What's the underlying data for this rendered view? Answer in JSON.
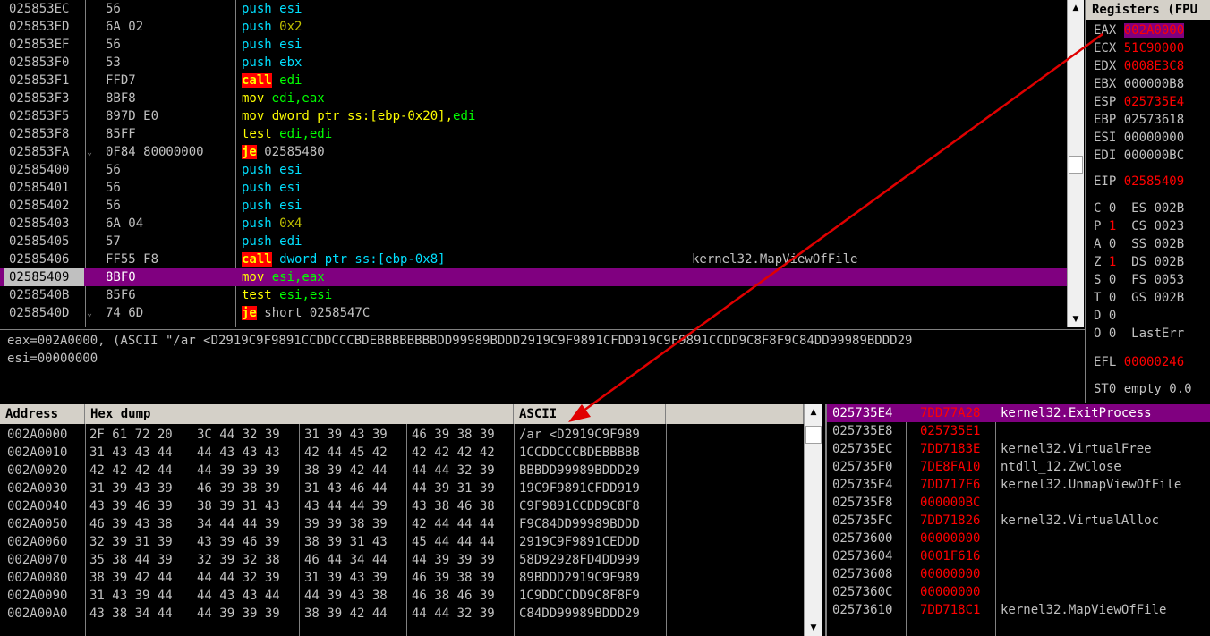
{
  "cpu_rows": [
    {
      "addr": "025853EC",
      "arrow": "",
      "hex": "56",
      "parts": [
        {
          "t": "push ",
          "c": "kw-push"
        },
        {
          "t": "esi",
          "c": "op-mem"
        }
      ],
      "comment": ""
    },
    {
      "addr": "025853ED",
      "arrow": "",
      "hex": "6A 02",
      "parts": [
        {
          "t": "push ",
          "c": "kw-push"
        },
        {
          "t": "0x2",
          "c": "op-imm"
        }
      ],
      "comment": ""
    },
    {
      "addr": "025853EF",
      "arrow": "",
      "hex": "56",
      "parts": [
        {
          "t": "push ",
          "c": "kw-push"
        },
        {
          "t": "esi",
          "c": "op-mem"
        }
      ],
      "comment": ""
    },
    {
      "addr": "025853F0",
      "arrow": "",
      "hex": "53",
      "parts": [
        {
          "t": "push ",
          "c": "kw-push"
        },
        {
          "t": "ebx",
          "c": "op-mem"
        }
      ],
      "comment": ""
    },
    {
      "addr": "025853F1",
      "arrow": "",
      "hex": "FFD7",
      "parts": [
        {
          "t": "call",
          "c": "kw-call"
        },
        {
          "t": " edi",
          "c": "op-reg"
        }
      ],
      "comment": ""
    },
    {
      "addr": "025853F3",
      "arrow": "",
      "hex": "8BF8",
      "parts": [
        {
          "t": "mov ",
          "c": "kw-mov"
        },
        {
          "t": "edi,eax",
          "c": "op-reg"
        }
      ],
      "comment": ""
    },
    {
      "addr": "025853F5",
      "arrow": "",
      "hex": "897D E0",
      "parts": [
        {
          "t": "mov dword ptr ss:[ebp-0x20],",
          "c": "kw-mov"
        },
        {
          "t": "edi",
          "c": "op-reg"
        }
      ],
      "comment": ""
    },
    {
      "addr": "025853F8",
      "arrow": "",
      "hex": "85FF",
      "parts": [
        {
          "t": "test ",
          "c": "kw-test"
        },
        {
          "t": "edi,edi",
          "c": "op-reg"
        }
      ],
      "comment": ""
    },
    {
      "addr": "025853FA",
      "arrow": "⌄",
      "hex": "0F84 80000000",
      "parts": [
        {
          "t": "je",
          "c": "kw-je"
        },
        {
          "t": " 02585480",
          "c": ""
        }
      ],
      "comment": ""
    },
    {
      "addr": "02585400",
      "arrow": "",
      "hex": "56",
      "parts": [
        {
          "t": "push ",
          "c": "kw-push"
        },
        {
          "t": "esi",
          "c": "op-mem"
        }
      ],
      "comment": ""
    },
    {
      "addr": "02585401",
      "arrow": "",
      "hex": "56",
      "parts": [
        {
          "t": "push ",
          "c": "kw-push"
        },
        {
          "t": "esi",
          "c": "op-mem"
        }
      ],
      "comment": ""
    },
    {
      "addr": "02585402",
      "arrow": "",
      "hex": "56",
      "parts": [
        {
          "t": "push ",
          "c": "kw-push"
        },
        {
          "t": "esi",
          "c": "op-mem"
        }
      ],
      "comment": ""
    },
    {
      "addr": "02585403",
      "arrow": "",
      "hex": "6A 04",
      "parts": [
        {
          "t": "push ",
          "c": "kw-push"
        },
        {
          "t": "0x4",
          "c": "op-imm"
        }
      ],
      "comment": ""
    },
    {
      "addr": "02585405",
      "arrow": "",
      "hex": "57",
      "parts": [
        {
          "t": "push ",
          "c": "kw-push"
        },
        {
          "t": "edi",
          "c": "op-mem"
        }
      ],
      "comment": ""
    },
    {
      "addr": "02585406",
      "arrow": "",
      "hex": "FF55 F8",
      "parts": [
        {
          "t": "call",
          "c": "kw-call"
        },
        {
          "t": " dword ptr ss:[ebp-0x8]",
          "c": "op-mem"
        }
      ],
      "comment": "kernel32.MapViewOfFile"
    },
    {
      "addr": "02585409",
      "arrow": "",
      "hex": "8BF0",
      "parts": [
        {
          "t": "mov ",
          "c": "kw-mov"
        },
        {
          "t": "esi,eax",
          "c": "op-reg"
        }
      ],
      "comment": "",
      "selected": true
    },
    {
      "addr": "0258540B",
      "arrow": "",
      "hex": "85F6",
      "parts": [
        {
          "t": "test ",
          "c": "kw-test"
        },
        {
          "t": "esi,esi",
          "c": "op-reg"
        }
      ],
      "comment": ""
    },
    {
      "addr": "0258540D",
      "arrow": "⌄",
      "hex": "74 6D",
      "parts": [
        {
          "t": "je",
          "c": "kw-je"
        },
        {
          "t": " short 0258547C",
          "c": ""
        }
      ],
      "comment": ""
    }
  ],
  "info": {
    "line1": "eax=002A0000, (ASCII \"/ar <D2919C9F9891CCDDCCCBDEBBBBBBBBDD99989BDDD2919C9F9891CFDD919C9F9891CCDD9C8F8F9C84DD99989BDDD29",
    "line2": "esi=00000000"
  },
  "registers": {
    "header": "Registers (FPU",
    "gp": [
      {
        "name": "EAX",
        "value": "002A0000",
        "style": "hl"
      },
      {
        "name": "ECX",
        "value": "51C90000",
        "style": "red"
      },
      {
        "name": "EDX",
        "value": "0008E3C8",
        "style": "red"
      },
      {
        "name": "EBX",
        "value": "000000B8",
        "style": ""
      },
      {
        "name": "ESP",
        "value": "025735E4",
        "style": "red"
      },
      {
        "name": "EBP",
        "value": "02573618",
        "style": ""
      },
      {
        "name": "ESI",
        "value": "00000000",
        "style": ""
      },
      {
        "name": "EDI",
        "value": "000000BC",
        "style": ""
      }
    ],
    "eip": {
      "name": "EIP",
      "value": "02585409"
    },
    "flags": [
      {
        "f": "C",
        "v": "0",
        "seg": "ES",
        "segv": "002B",
        "red": false
      },
      {
        "f": "P",
        "v": "1",
        "seg": "CS",
        "segv": "0023",
        "red": true
      },
      {
        "f": "A",
        "v": "0",
        "seg": "SS",
        "segv": "002B",
        "red": false
      },
      {
        "f": "Z",
        "v": "1",
        "seg": "DS",
        "segv": "002B",
        "red": true
      },
      {
        "f": "S",
        "v": "0",
        "seg": "FS",
        "segv": "0053",
        "red": false
      },
      {
        "f": "T",
        "v": "0",
        "seg": "GS",
        "segv": "002B",
        "red": false
      },
      {
        "f": "D",
        "v": "0",
        "seg": "",
        "segv": "",
        "red": false
      },
      {
        "f": "O",
        "v": "0",
        "seg": "LastErr",
        "segv": "",
        "red": false
      }
    ],
    "efl": {
      "name": "EFL",
      "value": "00000246"
    },
    "st0": "ST0 empty 0.0"
  },
  "dump": {
    "headers": {
      "address": "Address",
      "hex": "Hex dump",
      "ascii": "ASCII"
    },
    "rows": [
      {
        "addr": "002A0000",
        "hex": [
          "2F 61 72 20",
          "3C 44 32 39",
          "31 39 43 39",
          "46 39 38 39"
        ],
        "ascii": "/ar <D2919C9F989"
      },
      {
        "addr": "002A0010",
        "hex": [
          "31 43 43 44",
          "44 43 43 43",
          "42 44 45 42",
          "42 42 42 42"
        ],
        "ascii": "1CCDDCCCBDEBBBBB"
      },
      {
        "addr": "002A0020",
        "hex": [
          "42 42 42 44",
          "44 39 39 39",
          "38 39 42 44",
          "44 44 32 39"
        ],
        "ascii": "BBBDD99989BDDD29"
      },
      {
        "addr": "002A0030",
        "hex": [
          "31 39 43 39",
          "46 39 38 39",
          "31 43 46 44",
          "44 39 31 39"
        ],
        "ascii": "19C9F9891CFDD919"
      },
      {
        "addr": "002A0040",
        "hex": [
          "43 39 46 39",
          "38 39 31 43",
          "43 44 44 39",
          "43 38 46 38"
        ],
        "ascii": "C9F9891CCDD9C8F8"
      },
      {
        "addr": "002A0050",
        "hex": [
          "46 39 43 38",
          "34 44 44 39",
          "39 39 38 39",
          "42 44 44 44"
        ],
        "ascii": "F9C84DD99989BDDD"
      },
      {
        "addr": "002A0060",
        "hex": [
          "32 39 31 39",
          "43 39 46 39",
          "38 39 31 43",
          "45 44 44 44"
        ],
        "ascii": "2919C9F9891CEDDD"
      },
      {
        "addr": "002A0070",
        "hex": [
          "35 38 44 39",
          "32 39 32 38",
          "46 44 34 44",
          "44 39 39 39"
        ],
        "ascii": "58D92928FD4DD999"
      },
      {
        "addr": "002A0080",
        "hex": [
          "38 39 42 44",
          "44 44 32 39",
          "31 39 43 39",
          "46 39 38 39"
        ],
        "ascii": "89BDDD2919C9F989"
      },
      {
        "addr": "002A0090",
        "hex": [
          "31 43 39 44",
          "44 43 43 44",
          "44 39 43 38",
          "46 38 46 39"
        ],
        "ascii": "1C9DDCCDD9C8F8F9"
      },
      {
        "addr": "002A00A0",
        "hex": [
          "43 38 34 44",
          "44 39 39 39",
          "38 39 42 44",
          "44 44 32 39"
        ],
        "ascii": "C84DD99989BDDD29"
      }
    ]
  },
  "stack": {
    "rows": [
      {
        "addr": "025735E4",
        "val": "7DD77A28",
        "cmt": "kernel32.ExitProcess",
        "selected": true
      },
      {
        "addr": "025735E8",
        "val": "025735E1",
        "cmt": ""
      },
      {
        "addr": "025735EC",
        "val": "7DD7183E",
        "cmt": "kernel32.VirtualFree"
      },
      {
        "addr": "025735F0",
        "val": "7DE8FA10",
        "cmt": "ntdll_12.ZwClose"
      },
      {
        "addr": "025735F4",
        "val": "7DD717F6",
        "cmt": "kernel32.UnmapViewOfFile"
      },
      {
        "addr": "025735F8",
        "val": "000000BC",
        "cmt": ""
      },
      {
        "addr": "025735FC",
        "val": "7DD71826",
        "cmt": "kernel32.VirtualAlloc"
      },
      {
        "addr": "02573600",
        "val": "00000000",
        "cmt": ""
      },
      {
        "addr": "02573604",
        "val": "0001F616",
        "cmt": ""
      },
      {
        "addr": "02573608",
        "val": "00000000",
        "cmt": ""
      },
      {
        "addr": "0257360C",
        "val": "00000000",
        "cmt": ""
      },
      {
        "addr": "02573610",
        "val": "7DD718C1",
        "cmt": "kernel32.MapViewOfFile"
      }
    ]
  },
  "colors": {
    "selection": "#800080",
    "annotation_arrow": "#e00000"
  }
}
